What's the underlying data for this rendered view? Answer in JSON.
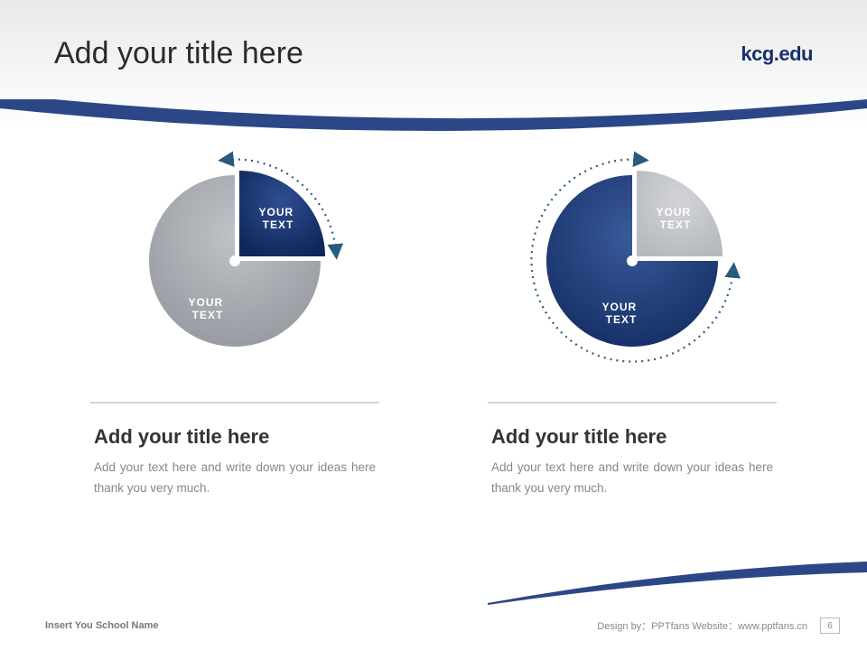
{
  "header": {
    "title": "Add your title here",
    "logo": "kcg.edu"
  },
  "colors": {
    "accent_dark": "#1c3a78",
    "accent_grad_top": "#0f275a",
    "accent_grad_bot": "#2f4e91",
    "grey_slice": "#a6aab0",
    "grey_light": "#c3c6cb",
    "dotted": "#2a5a7d"
  },
  "chart_data": [
    {
      "type": "pie",
      "title": "Add your title here",
      "subtitle": "Add your text here and write down your ideas here thank you very much.",
      "series": [
        {
          "name": "YOUR TEXT",
          "value": 25,
          "color": "accent"
        },
        {
          "name": "YOUR TEXT",
          "value": 75,
          "color": "grey"
        }
      ],
      "arc_start_deg": -30,
      "arc_end_deg": 100
    },
    {
      "type": "pie",
      "title": "Add your title here",
      "subtitle": "Add your text here and write down your ideas here thank you very much.",
      "series": [
        {
          "name": "YOUR TEXT",
          "value": 25,
          "color": "grey_light"
        },
        {
          "name": "YOUR TEXT",
          "value": 75,
          "color": "accent"
        }
      ],
      "arc_start_deg": -40,
      "arc_end_deg": 260
    }
  ],
  "footer": {
    "school": "Insert You School Name",
    "credit": "Design by：PPTfans  Website：www.pptfans.cn",
    "page": "6"
  }
}
